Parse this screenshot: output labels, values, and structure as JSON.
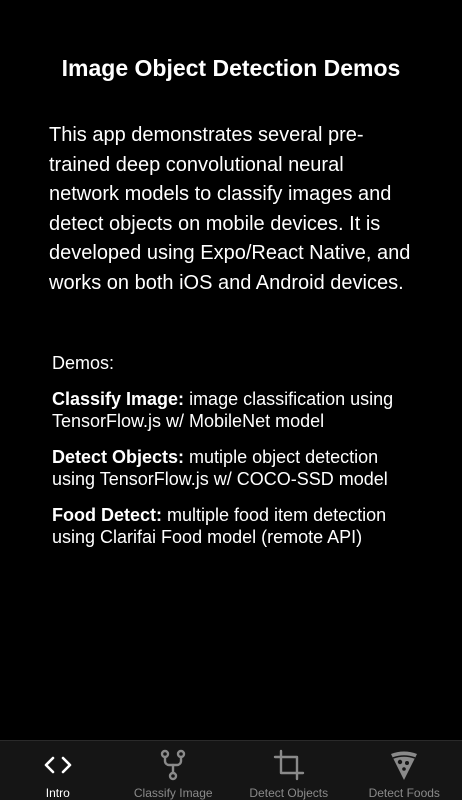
{
  "header": {
    "title": "Image Object Detection Demos"
  },
  "intro": {
    "text": "This app demonstrates several pre-trained deep convolutional neural network models to classify images and detect objects on mobile devices. It is developed using Expo/React Native, and works on both iOS and Android devices."
  },
  "demos": {
    "heading": "Demos:",
    "items": [
      {
        "name": "Classify Image:",
        "description": " image classification using TensorFlow.js w/ MobileNet model"
      },
      {
        "name": "Detect Objects:",
        "description": " mutiple object detection using TensorFlow.js w/ COCO-SSD model"
      },
      {
        "name": "Food Detect:",
        "description": " multiple food item detection using Clarifai Food model (remote API)"
      }
    ]
  },
  "tabbar": {
    "active_color": "#ffffff",
    "inactive_color": "#8a8a8a",
    "tabs": [
      {
        "label": "Intro",
        "icon": "code-icon",
        "active": true
      },
      {
        "label": "Classify Image",
        "icon": "fork-icon",
        "active": false
      },
      {
        "label": "Detect Objects",
        "icon": "crop-icon",
        "active": false
      },
      {
        "label": "Detect Foods",
        "icon": "pizza-icon",
        "active": false
      }
    ]
  }
}
